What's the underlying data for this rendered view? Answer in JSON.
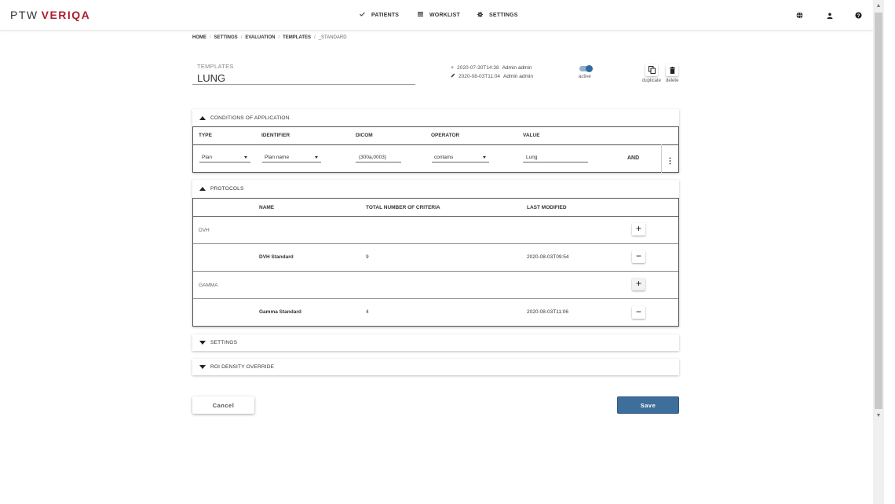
{
  "app": {
    "logo_left": "PTW",
    "logo_right": "VERIQA"
  },
  "nav": {
    "patients": "PATIENTS",
    "worklist": "WORKLIST",
    "settings": "SETTINGS"
  },
  "top_icons": [
    "globe-icon",
    "user-icon",
    "help-icon"
  ],
  "breadcrumb": {
    "items": [
      "HOME",
      "SETTINGS",
      "EVALUATION",
      "TEMPLATES"
    ],
    "separator": "/",
    "current": "_STANDARD"
  },
  "template": {
    "label": "TEMPLATES",
    "name": "LUNG",
    "created": {
      "date": "2020-07-30T14:38",
      "user": "Admin admin"
    },
    "modified": {
      "date": "2020-08-03T11:04",
      "user": "Admin admin"
    },
    "active_label": "active",
    "active": true,
    "duplicate_label": "duplicate",
    "delete_label": "delete"
  },
  "conditions": {
    "title": "CONDITIONS OF APPLICATION",
    "headers": {
      "type": "TYPE",
      "identifier": "IDENTIFIER",
      "dicom": "DICOM",
      "operator": "OPERATOR",
      "value": "VALUE"
    },
    "row": {
      "type": "Plan",
      "identifier": "Plan name",
      "dicom": "(300a,0003)",
      "operator": "contains",
      "value": "Lung",
      "logic": "AND"
    }
  },
  "protocols": {
    "title": "PROTOCOLS",
    "headers": {
      "name": "NAME",
      "total": "TOTAL NUMBER OF CRITERIA",
      "modified": "LAST MODIFIED"
    },
    "groups": [
      {
        "label": "DVH",
        "item": {
          "name": "DVH Standard",
          "count": "9",
          "modified": "2020-08-03T09:54"
        }
      },
      {
        "label": "GAMMA",
        "item": {
          "name": "Gamma Standard",
          "count": "4",
          "modified": "2020-08-03T11:06"
        }
      }
    ]
  },
  "settings_panel": {
    "title": "SETTINGS"
  },
  "roi_panel": {
    "title": "ROI DENSITY OVERRIDE"
  },
  "buttons": {
    "cancel": "Cancel",
    "save": "Save"
  },
  "colors": {
    "brand": "#b01c2e",
    "primary": "#3e6e9a",
    "toggle": "#2f6aa0"
  }
}
